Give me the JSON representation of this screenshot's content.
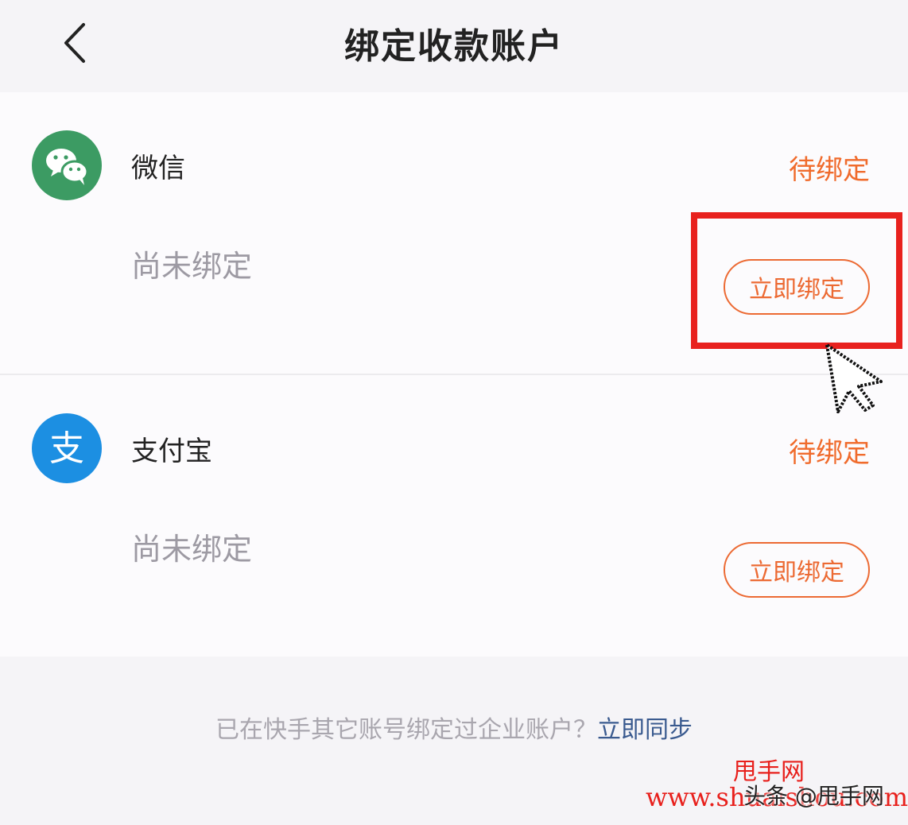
{
  "header": {
    "title": "绑定收款账户"
  },
  "accounts": [
    {
      "name": "微信",
      "status": "待绑定",
      "sub_status": "尚未绑定",
      "button_label": "立即绑定",
      "icon": "wechat-icon",
      "icon_color": "#3c9b63"
    },
    {
      "name": "支付宝",
      "status": "待绑定",
      "sub_status": "尚未绑定",
      "button_label": "立即绑定",
      "icon": "alipay-icon",
      "icon_color": "#1c8fe2",
      "icon_text": "支"
    }
  ],
  "footer": {
    "text": "已在快手其它账号绑定过企业账户？",
    "link": "立即同步"
  },
  "watermark": {
    "site_name": "甩手网",
    "url": "www.shuaishou.com",
    "toutiao": "头条 @甩手网"
  },
  "colors": {
    "accent": "#f06b2c",
    "highlight": "#e8211e",
    "link": "#3a5a8f"
  }
}
